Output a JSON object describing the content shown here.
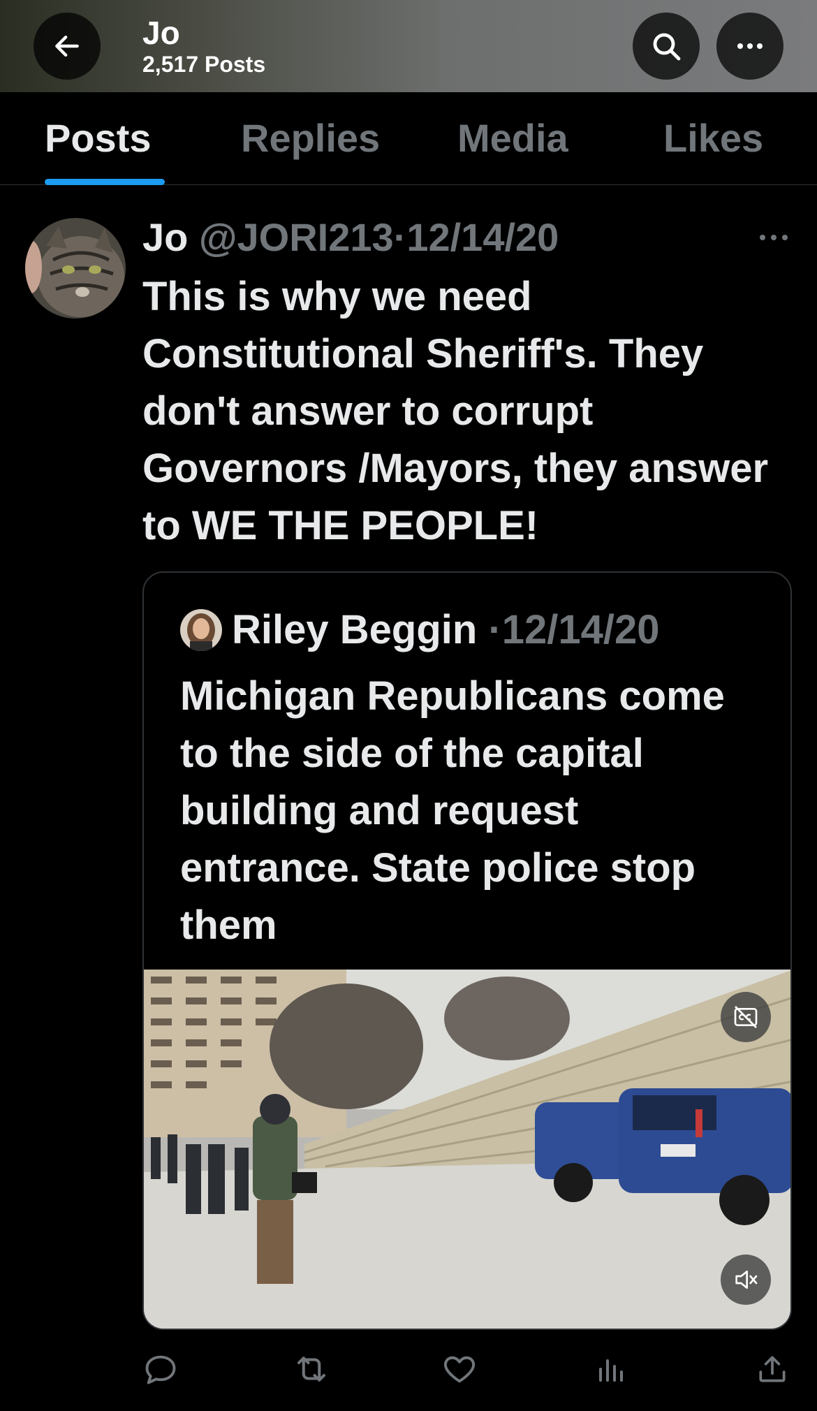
{
  "header": {
    "title": "Jo",
    "post_count": "2,517 Posts",
    "back_icon": "arrow-left-icon",
    "search_icon": "search-icon",
    "more_icon": "more-horizontal-icon"
  },
  "tabs": [
    {
      "label": "Posts",
      "active": true
    },
    {
      "label": "Replies",
      "active": false
    },
    {
      "label": "Media",
      "active": false
    },
    {
      "label": "Likes",
      "active": false
    }
  ],
  "post": {
    "author_name": "Jo",
    "handle": "@JORI213",
    "separator": "·",
    "date": "12/14/20",
    "text": "This is why we need Constitutional Sheriff's. They don't  answer to corrupt Governors /Mayors, they answer to WE THE PEOPLE!",
    "quote": {
      "author_name": "Riley Beggin",
      "separator": "·",
      "date": "12/14/20",
      "text": "Michigan Republicans come to the side of the capital building and request entrance. State police stop them",
      "media_buttons": [
        "closed-captions-icon",
        "mute-icon"
      ]
    },
    "actions": [
      "reply-icon",
      "repost-icon",
      "like-icon",
      "views-icon",
      "share-icon"
    ]
  },
  "colors": {
    "accent": "#1d9bf0",
    "text_primary": "#e7e9ea",
    "text_secondary": "#71767b",
    "background": "#000000",
    "divider": "#2f3336"
  }
}
